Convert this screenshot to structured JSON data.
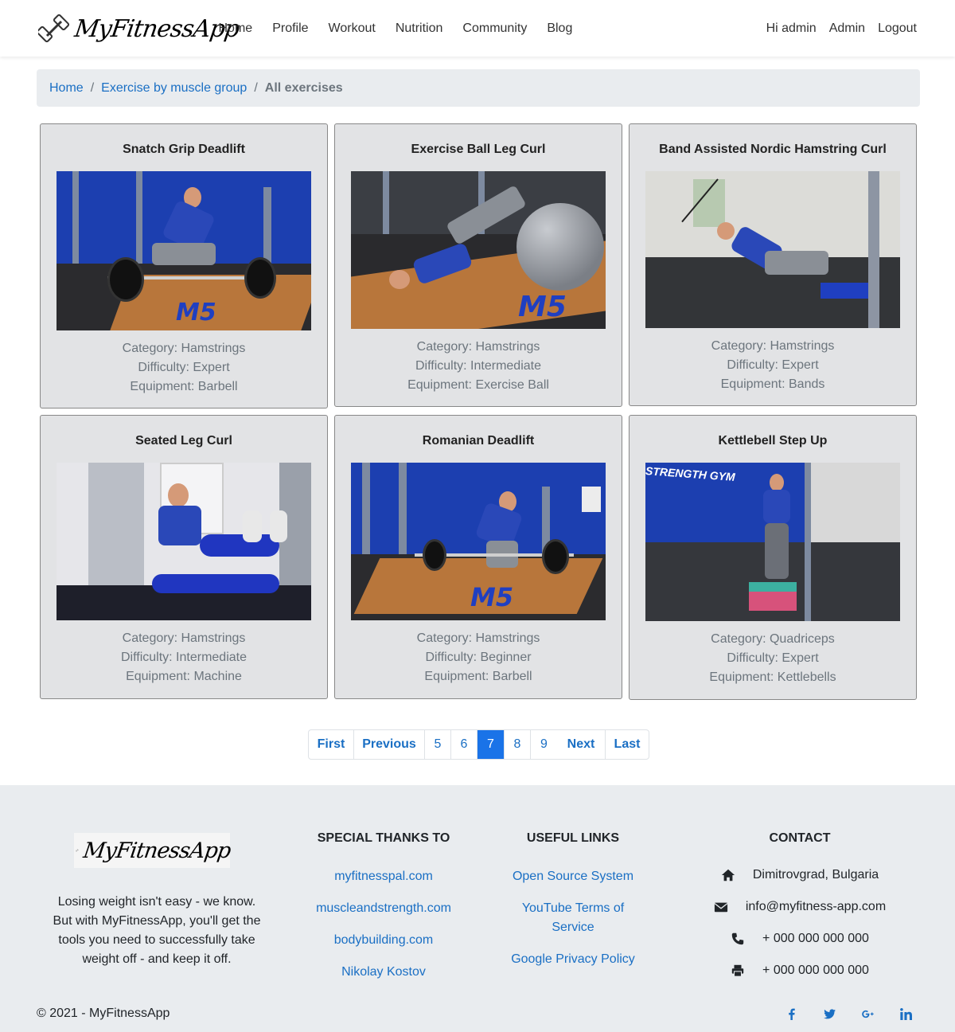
{
  "navbar": {
    "brand": "MyFitnessApp",
    "links": [
      "Home",
      "Profile",
      "Workout",
      "Nutrition",
      "Community",
      "Blog"
    ],
    "greeting": "Hi admin",
    "admin": "Admin",
    "logout": "Logout"
  },
  "breadcrumb": {
    "home": "Home",
    "group": "Exercise by muscle group",
    "current": "All exercises",
    "separator": "/"
  },
  "cards": [
    {
      "title": "Snatch Grip Deadlift",
      "category": "Category: Hamstrings",
      "difficulty": "Difficulty: Expert",
      "equipment": "Equipment: Barbell"
    },
    {
      "title": "Exercise Ball Leg Curl",
      "category": "Category: Hamstrings",
      "difficulty": "Difficulty: Intermediate",
      "equipment": "Equipment: Exercise Ball"
    },
    {
      "title": "Band Assisted Nordic Hamstring Curl",
      "category": "Category: Hamstrings",
      "difficulty": "Difficulty: Expert",
      "equipment": "Equipment: Bands"
    },
    {
      "title": "Seated Leg Curl",
      "category": "Category: Hamstrings",
      "difficulty": "Difficulty: Intermediate",
      "equipment": "Equipment: Machine"
    },
    {
      "title": "Romanian Deadlift",
      "category": "Category: Hamstrings",
      "difficulty": "Difficulty: Beginner",
      "equipment": "Equipment: Barbell"
    },
    {
      "title": "Kettlebell Step Up",
      "category": "Category: Quadriceps",
      "difficulty": "Difficulty: Expert",
      "equipment": "Equipment: Kettlebells"
    }
  ],
  "pagination": {
    "first": "First",
    "previous": "Previous",
    "pages": [
      "5",
      "6",
      "7",
      "8",
      "9"
    ],
    "current": "7",
    "next": "Next",
    "last": "Last"
  },
  "footer": {
    "brand": "MyFitnessApp",
    "about": "Losing weight isn't easy - we know. But with MyFitnessApp, you'll get the tools you need to successfully take weight off - and keep it off.",
    "thanks": {
      "heading": "SPECIAL THANKS TO",
      "links": [
        "myfitnesspal.com",
        "muscleandstrength.com",
        "bodybuilding.com",
        "Nikolay Kostov"
      ]
    },
    "useful": {
      "heading": "USEFUL LINKS",
      "links": [
        "Open Source System",
        "YouTube Terms of Service",
        "Google Privacy Policy"
      ]
    },
    "contact": {
      "heading": "CONTACT",
      "address": "Dimitrovgrad, Bulgaria",
      "email": "info@myfitness-app.com",
      "phone": "+ 000 000 000 000",
      "fax": "+ 000 000 000 000"
    },
    "copyright": "© 2021 - MyFitnessApp",
    "social": [
      "facebook-icon",
      "twitter-icon",
      "google-plus-icon",
      "linkedin-icon"
    ]
  },
  "colors": {
    "link": "#1a6fc4",
    "active_page": "#1a73e8",
    "card_bg": "#e2e3e5",
    "breadcrumb_bg": "#e9ecef",
    "footer_bg": "#e9ecef"
  }
}
